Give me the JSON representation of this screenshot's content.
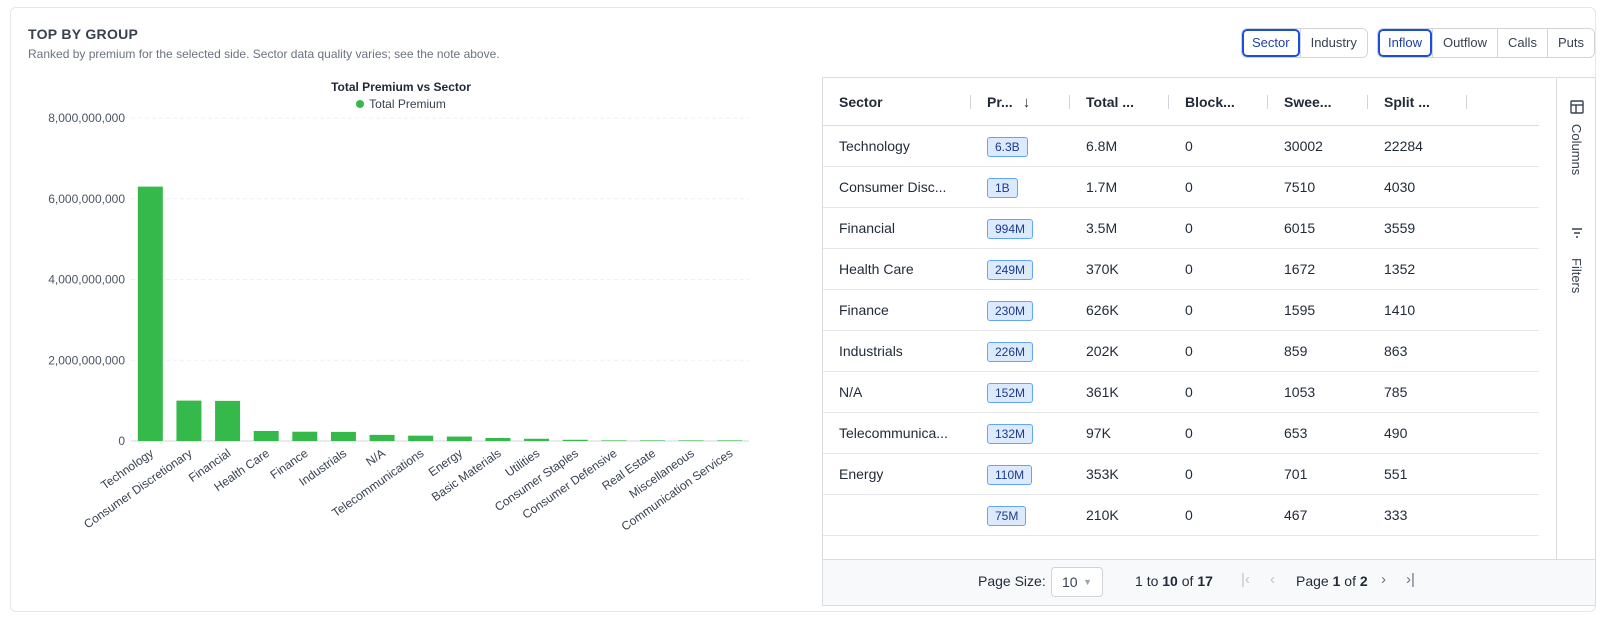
{
  "header": {
    "title": "TOP BY GROUP",
    "subtitle": "Ranked by premium for the selected side. Sector data quality varies; see the note above."
  },
  "group_toggle": {
    "options": [
      "Sector",
      "Industry"
    ],
    "selected": "Sector"
  },
  "side_toggle": {
    "options": [
      "Inflow",
      "Outflow",
      "Calls",
      "Puts"
    ],
    "selected": "Inflow"
  },
  "colors": {
    "bar": "#34b94a",
    "accent": "#1d4ed8",
    "pill_bg": "#dbeafe",
    "pill_border": "#60a5fa"
  },
  "chart_data": {
    "type": "bar",
    "title": "Total Premium vs Sector",
    "legend": [
      "Total Premium"
    ],
    "legend_placement": "top-center",
    "grid": true,
    "categories": [
      "Technology",
      "Consumer Discretionary",
      "Financial",
      "Health Care",
      "Finance",
      "Industrials",
      "N/A",
      "Telecommunications",
      "Energy",
      "Basic Materials",
      "Utilities",
      "Consumer Staples",
      "Consumer Defensive",
      "Real Estate",
      "Miscellaneous",
      "Communication Services"
    ],
    "series": [
      {
        "name": "Total Premium",
        "values": [
          6300000000,
          1000000000,
          994000000,
          249000000,
          230000000,
          226000000,
          152000000,
          132000000,
          110000000,
          75000000,
          55000000,
          30000000,
          15000000,
          8000000,
          3000000,
          1000000
        ]
      }
    ],
    "ylim": [
      0,
      8000000000
    ],
    "yticks": [
      0,
      2000000000,
      4000000000,
      6000000000,
      8000000000
    ],
    "ytick_labels": [
      "0",
      "2,000,000,000",
      "4,000,000,000",
      "6,000,000,000",
      "8,000,000,000"
    ]
  },
  "table": {
    "headers": [
      "Sector",
      "Pr...",
      "Total ...",
      "Block...",
      "Swee...",
      "Split ..."
    ],
    "sort_icon": "arrow-down-icon",
    "rows": [
      [
        "Technology",
        "6.3B",
        "6.8M",
        "0",
        "30002",
        "22284"
      ],
      [
        "Consumer Disc...",
        "1B",
        "1.7M",
        "0",
        "7510",
        "4030"
      ],
      [
        "Financial",
        "994M",
        "3.5M",
        "0",
        "6015",
        "3559"
      ],
      [
        "Health Care",
        "249M",
        "370K",
        "0",
        "1672",
        "1352"
      ],
      [
        "Finance",
        "230M",
        "626K",
        "0",
        "1595",
        "1410"
      ],
      [
        "Industrials",
        "226M",
        "202K",
        "0",
        "859",
        "863"
      ],
      [
        "N/A",
        "152M",
        "361K",
        "0",
        "1053",
        "785"
      ],
      [
        "Telecommunica...",
        "132M",
        "97K",
        "0",
        "653",
        "490"
      ],
      [
        "Energy",
        "110M",
        "353K",
        "0",
        "701",
        "551"
      ],
      [
        "",
        "75M",
        "210K",
        "0",
        "467",
        "333"
      ]
    ]
  },
  "side_panel": {
    "columns_label": "Columns",
    "filters_label": "Filters"
  },
  "pager": {
    "page_size_label": "Page Size:",
    "page_size": "10",
    "range_from": "1",
    "range_to_word": "to",
    "range_to": "10",
    "of_word": "of",
    "total": "17",
    "page_word": "Page",
    "current_page": "1",
    "page_of_word": "of",
    "page_count": "2"
  }
}
